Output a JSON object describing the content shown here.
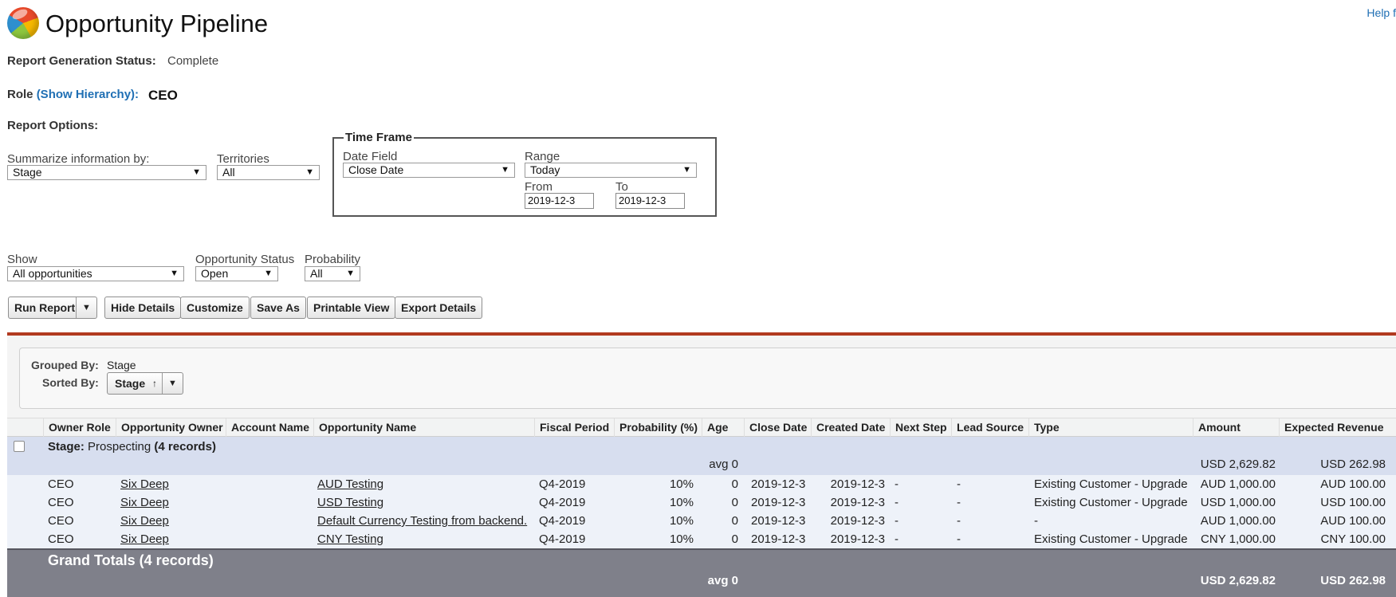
{
  "header": {
    "title": "Opportunity Pipeline",
    "help_link": "Help f",
    "logo_icon": "salesforce-cloud-logo"
  },
  "status": {
    "label": "Report Generation Status:",
    "value": "Complete"
  },
  "role": {
    "label": "Role",
    "hierarchy_link": "(Show Hierarchy):",
    "value": "CEO"
  },
  "report_options": {
    "label": "Report Options:",
    "summarize_label": "Summarize information by:",
    "summarize_value": "Stage",
    "territories_label": "Territories",
    "territories_value": "All",
    "show_label": "Show",
    "show_value": "All opportunities",
    "opp_status_label": "Opportunity Status",
    "opp_status_value": "Open",
    "probability_label": "Probability",
    "probability_value": "All"
  },
  "time_frame": {
    "legend": "Time Frame",
    "date_field_label": "Date Field",
    "date_field_value": "Close Date",
    "range_label": "Range",
    "range_value": "Today",
    "from_label": "From",
    "from_value": "2019-12-3",
    "to_label": "To",
    "to_value": "2019-12-3"
  },
  "buttons": {
    "run_report": "Run Report",
    "hide_details": "Hide Details",
    "customize": "Customize",
    "save_as": "Save As",
    "printable_view": "Printable View",
    "export_details": "Export Details"
  },
  "grouping": {
    "grouped_by_label": "Grouped By:",
    "grouped_by_value": "Stage",
    "sorted_by_label": "Sorted By:",
    "sorted_by_value": "Stage",
    "sort_icon": "arrow-up-icon"
  },
  "table": {
    "columns": [
      "Owner Role",
      "Opportunity Owner",
      "Account Name",
      "Opportunity Name",
      "Fiscal Period",
      "Probability (%)",
      "Age",
      "Close Date",
      "Created Date",
      "Next Step",
      "Lead Source",
      "Type",
      "Amount",
      "Expected Revenue"
    ],
    "group": {
      "stage_label": "Stage:",
      "stage_value": "Prospecting",
      "count": "(4 records)",
      "age_avg": "avg 0",
      "amount_total": "USD 2,629.82",
      "expected_total": "USD 262.98"
    },
    "rows": [
      {
        "owner_role": "CEO",
        "owner": "Six Deep",
        "account": "",
        "name": "AUD Testing",
        "fiscal": "Q4-2019",
        "prob": "10%",
        "age": "0",
        "close": "2019-12-3",
        "created": "2019-12-3",
        "next_step": "-",
        "lead_source": "-",
        "type": "Existing Customer - Upgrade",
        "amount": "AUD 1,000.00",
        "expected": "AUD 100.00"
      },
      {
        "owner_role": "CEO",
        "owner": "Six Deep",
        "account": "",
        "name": "USD Testing",
        "fiscal": "Q4-2019",
        "prob": "10%",
        "age": "0",
        "close": "2019-12-3",
        "created": "2019-12-3",
        "next_step": "-",
        "lead_source": "-",
        "type": "Existing Customer - Upgrade",
        "amount": "USD 1,000.00",
        "expected": "USD 100.00"
      },
      {
        "owner_role": "CEO",
        "owner": "Six Deep",
        "account": "",
        "name": "Default Currency Testing from backend.",
        "fiscal": "Q4-2019",
        "prob": "10%",
        "age": "0",
        "close": "2019-12-3",
        "created": "2019-12-3",
        "next_step": "-",
        "lead_source": "-",
        "type": "-",
        "amount": "AUD 1,000.00",
        "expected": "AUD 100.00"
      },
      {
        "owner_role": "CEO",
        "owner": "Six Deep",
        "account": "",
        "name": "CNY Testing",
        "fiscal": "Q4-2019",
        "prob": "10%",
        "age": "0",
        "close": "2019-12-3",
        "created": "2019-12-3",
        "next_step": "-",
        "lead_source": "-",
        "type": "Existing Customer - Upgrade",
        "amount": "CNY 1,000.00",
        "expected": "CNY 100.00"
      }
    ],
    "grand_totals": {
      "label": "Grand Totals (4 records)",
      "age_avg": "avg 0",
      "amount_total": "USD 2,629.82",
      "expected_total": "USD 262.98"
    }
  },
  "colors": {
    "accent_bar": "#b23a20",
    "link_blue": "#1f6fb4",
    "group_row_bg": "#d7deef",
    "grand_totals_bg": "#7f808a"
  }
}
